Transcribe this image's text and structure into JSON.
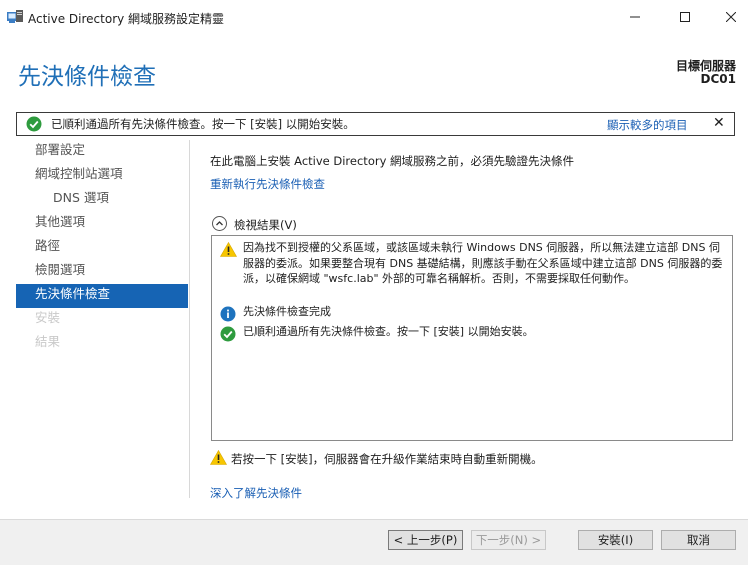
{
  "window": {
    "title": "Active Directory 網域服務設定精靈"
  },
  "header": {
    "page_title": "先決條件檢查",
    "target_label": "目標伺服器",
    "target_value": "DC01"
  },
  "notice": {
    "text": "已順利通過所有先決條件檢查。按一下 [安裝] 以開始安裝。",
    "more_link": "顯示較多的項目",
    "close": "✕"
  },
  "nav": {
    "items": [
      {
        "label": "部署設定",
        "state": "normal"
      },
      {
        "label": "網域控制站選項",
        "state": "normal"
      },
      {
        "label": "DNS 選項",
        "state": "sub"
      },
      {
        "label": "其他選項",
        "state": "normal"
      },
      {
        "label": "路徑",
        "state": "normal"
      },
      {
        "label": "檢閱選項",
        "state": "normal"
      },
      {
        "label": "先決條件檢查",
        "state": "active"
      },
      {
        "label": "安裝",
        "state": "disabled"
      },
      {
        "label": "結果",
        "state": "disabled"
      }
    ]
  },
  "content": {
    "intro": "在此電腦上安裝 Active Directory 網域服務之前，必須先驗證先決條件",
    "rerun_link": "重新執行先決條件檢查",
    "results_label": "檢視結果(V)",
    "results": [
      {
        "icon": "warning-icon",
        "text": "因為找不到授權的父系區域，或該區域未執行 Windows DNS 伺服器，所以無法建立這部 DNS 伺服器的委派。如果要整合現有 DNS 基礎結構，則應該手動在父系區域中建立這部 DNS 伺服器的委派，以確保網域 \"wsfc.lab\" 外部的可靠名稱解析。否則，不需要採取任何動作。"
      },
      {
        "icon": "info-icon",
        "text": "先決條件檢查完成"
      },
      {
        "icon": "check-icon",
        "text": "已順利通過所有先決條件檢查。按一下 [安裝] 以開始安裝。"
      }
    ],
    "footer_warning": "若按一下 [安裝]，伺服器會在升級作業結束時自動重新開機。",
    "more_link": "深入了解先決條件"
  },
  "buttons": {
    "prev": "< 上一步(P)",
    "next": "下一步(N) >",
    "install": "安裝(I)",
    "cancel": "取消"
  },
  "colors": {
    "accent": "#1664b4",
    "link": "#1a5fb4",
    "success": "#2e9b3e",
    "warning": "#f7c600",
    "info": "#1e73be"
  }
}
